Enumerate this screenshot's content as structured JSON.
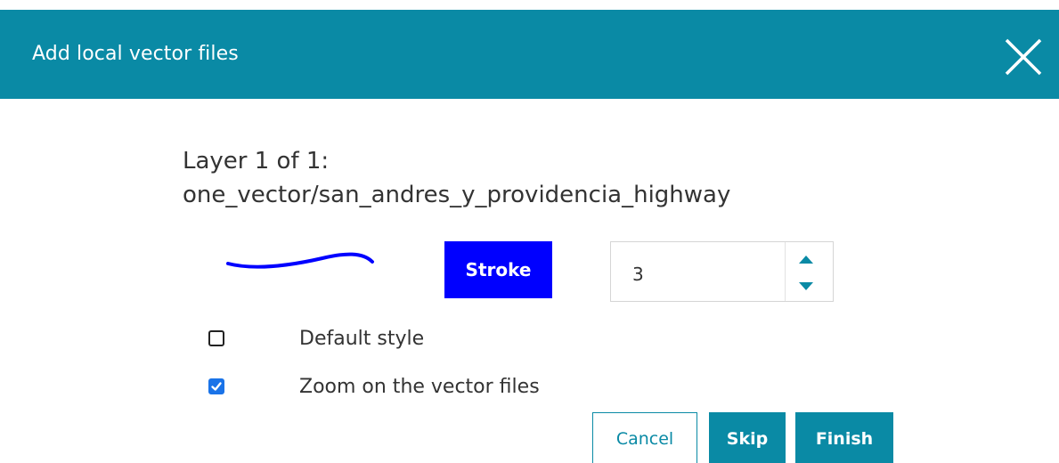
{
  "dialog": {
    "title": "Add local vector files",
    "close_icon": "close-icon"
  },
  "layer": {
    "heading": "Layer 1 of 1:",
    "name": "one_vector/san_andres_y_providencia_highway"
  },
  "style": {
    "stroke_label": "Stroke",
    "stroke_color": "#0000ff",
    "stroke_width": "3",
    "preview_icon": "line-preview-icon"
  },
  "options": {
    "default_style": {
      "label": "Default style",
      "checked": false
    },
    "zoom": {
      "label": "Zoom on the vector files",
      "checked": true
    }
  },
  "buttons": {
    "cancel": "Cancel",
    "skip": "Skip",
    "finish": "Finish"
  },
  "colors": {
    "accent": "#0a8aa5",
    "checkbox_checked": "#1a73e8"
  }
}
